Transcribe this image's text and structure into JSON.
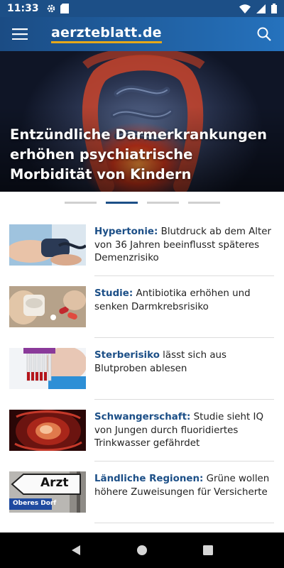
{
  "status_bar": {
    "time": "11:33",
    "icons": [
      "settings-icon",
      "sd-card-icon",
      "wifi-icon",
      "signal-icon",
      "battery-icon"
    ]
  },
  "app_bar": {
    "brand": "aerzteblatt.de",
    "accent_color": "#e5a81a",
    "bar_color": "#1c4f87"
  },
  "hero": {
    "title": "Entzündliche Darmerkrankungen erhöhen psychiatrische Morbidität von Kindern"
  },
  "pager": {
    "count": 4,
    "active_index": 1
  },
  "articles": [
    {
      "keyword": "Hypertonie:",
      "text": " Blutdruck ab dem Alter von 36 Jahren beeinflusst späteres Demenzrisiko",
      "thumb": "blood-pressure"
    },
    {
      "keyword": "Studie:",
      "text": " Antibiotika erhöhen und senken Darmkrebsrisiko",
      "thumb": "pills"
    },
    {
      "keyword": "Sterberisiko",
      "text": " lässt sich aus Blutproben ablesen",
      "thumb": "blood-samples"
    },
    {
      "keyword": "Schwangerschaft:",
      "text": " Studie sieht IQ von Jungen durch fluoridiertes Trinkwasser gefährdet",
      "thumb": "fetus"
    },
    {
      "keyword": "Ländliche Regionen:",
      "text": " Grüne wollen höhere Zuweisungen für Versicherte",
      "thumb": "road-sign",
      "sign_main": "Arzt",
      "sign_sub": "Oberes Dorf"
    }
  ]
}
